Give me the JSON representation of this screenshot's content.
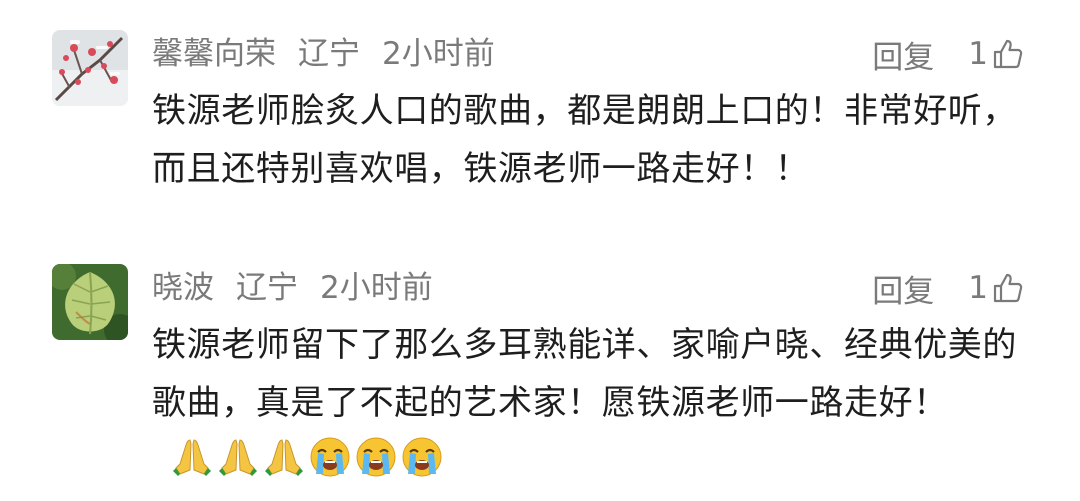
{
  "comments": [
    {
      "username": "馨馨向荣",
      "location": "辽宁",
      "time": "2小时前",
      "reply_label": "回复",
      "like_count": "1",
      "content": "铁源老师脍炙人口的歌曲，都是朗朗上口的！非常好听，而且还特别喜欢唱，铁源老师一路走好！！",
      "avatar_icon": "plum-blossom-avatar"
    },
    {
      "username": "晓波",
      "location": "辽宁",
      "time": "2小时前",
      "reply_label": "回复",
      "like_count": "1",
      "content": "铁源老师留下了那么多耳熟能详、家喻户晓、经典优美的歌曲，真是了不起的艺术家！愿铁源老师一路走好！",
      "emojis": [
        "folded-hands",
        "folded-hands",
        "folded-hands",
        "crying-face",
        "crying-face",
        "crying-face"
      ],
      "avatar_icon": "green-leaf-avatar"
    }
  ],
  "colors": {
    "meta_text": "#7a7a7a",
    "body_text": "#1e1e1e",
    "background": "#ffffff"
  }
}
